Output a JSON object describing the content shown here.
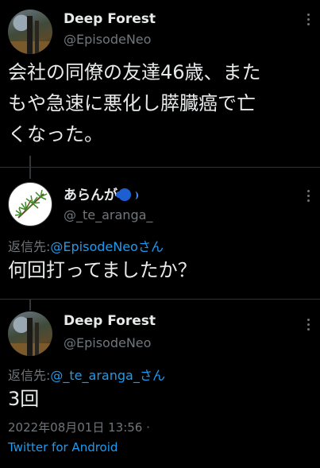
{
  "tweets": [
    {
      "name": "Deep Forest",
      "handle": "@EpisodeNeo",
      "text_lines": [
        "会社の同僚の友達46歳、また",
        "もや急速に悪化し膵臓癌で亡",
        "くなった。"
      ]
    },
    {
      "name": "あらんが",
      "handle": "@_te_aranga_",
      "reply_prefix": "返信先:",
      "reply_to": "@EpisodeNeo",
      "reply_suffix": "さん",
      "text": "何回打ってましたか？"
    },
    {
      "name": "Deep Forest",
      "handle": "@EpisodeNeo",
      "reply_prefix": "返信先:",
      "reply_to": "@_te_aranga_",
      "reply_suffix": "さん",
      "text": "3回",
      "timestamp": "2022年08月01日 13:56 ·",
      "source": "Twitter for Android"
    }
  ],
  "icons": [
    "more-icon",
    "speaking-head-icon"
  ],
  "colors": {
    "background": "#000000",
    "text": "#e7e9ea",
    "secondary": "#71767b",
    "link": "#1d9bf0"
  }
}
